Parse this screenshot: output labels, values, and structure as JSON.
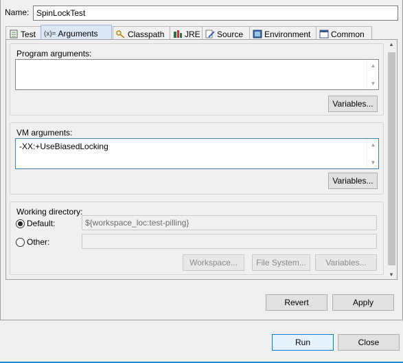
{
  "name_label": "Name:",
  "name_value": "SpinLockTest",
  "tabs": [
    {
      "label": "Test",
      "icon": "test-icon"
    },
    {
      "label": "Arguments",
      "icon": "arguments-icon",
      "prefix": "(x)="
    },
    {
      "label": "Classpath",
      "icon": "classpath-icon"
    },
    {
      "label": "JRE",
      "icon": "jre-icon"
    },
    {
      "label": "Source",
      "icon": "source-icon"
    },
    {
      "label": "Environment",
      "icon": "environment-icon"
    },
    {
      "label": "Common",
      "icon": "common-icon"
    }
  ],
  "program_args": {
    "title": "Program arguments:",
    "value": "",
    "variables_label": "Variables..."
  },
  "vm_args": {
    "title": "VM arguments:",
    "value": "-XX:+UseBiasedLocking",
    "variables_label": "Variables..."
  },
  "working_dir": {
    "title": "Working directory:",
    "default_label": "Default:",
    "default_value": "${workspace_loc:test-pilling}",
    "other_label": "Other:",
    "other_value": "",
    "workspace_label": "Workspace...",
    "filesystem_label": "File System...",
    "variables_label": "Variables...",
    "selected": "default"
  },
  "revert_label": "Revert",
  "apply_label": "Apply",
  "run_label": "Run",
  "close_label": "Close"
}
